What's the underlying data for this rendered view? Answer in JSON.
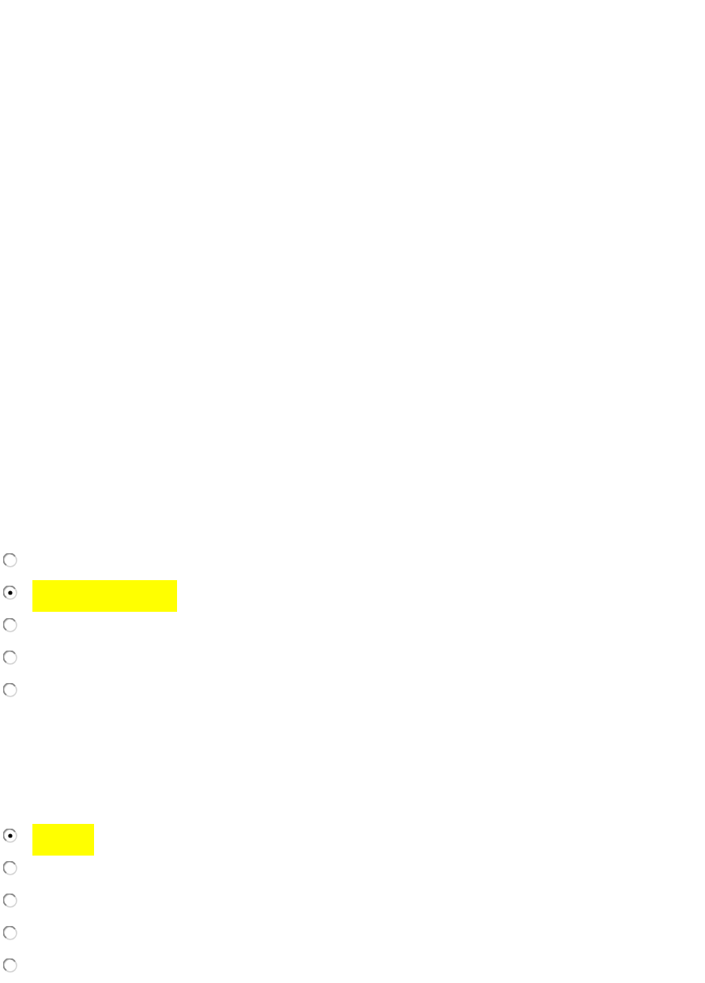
{
  "radio_groups": [
    {
      "options": [
        {
          "selected": false
        },
        {
          "selected": true
        },
        {
          "selected": false
        },
        {
          "selected": false
        },
        {
          "selected": false
        }
      ]
    },
    {
      "options": [
        {
          "selected": true
        },
        {
          "selected": false
        },
        {
          "selected": false
        },
        {
          "selected": false
        },
        {
          "selected": false
        }
      ]
    }
  ]
}
